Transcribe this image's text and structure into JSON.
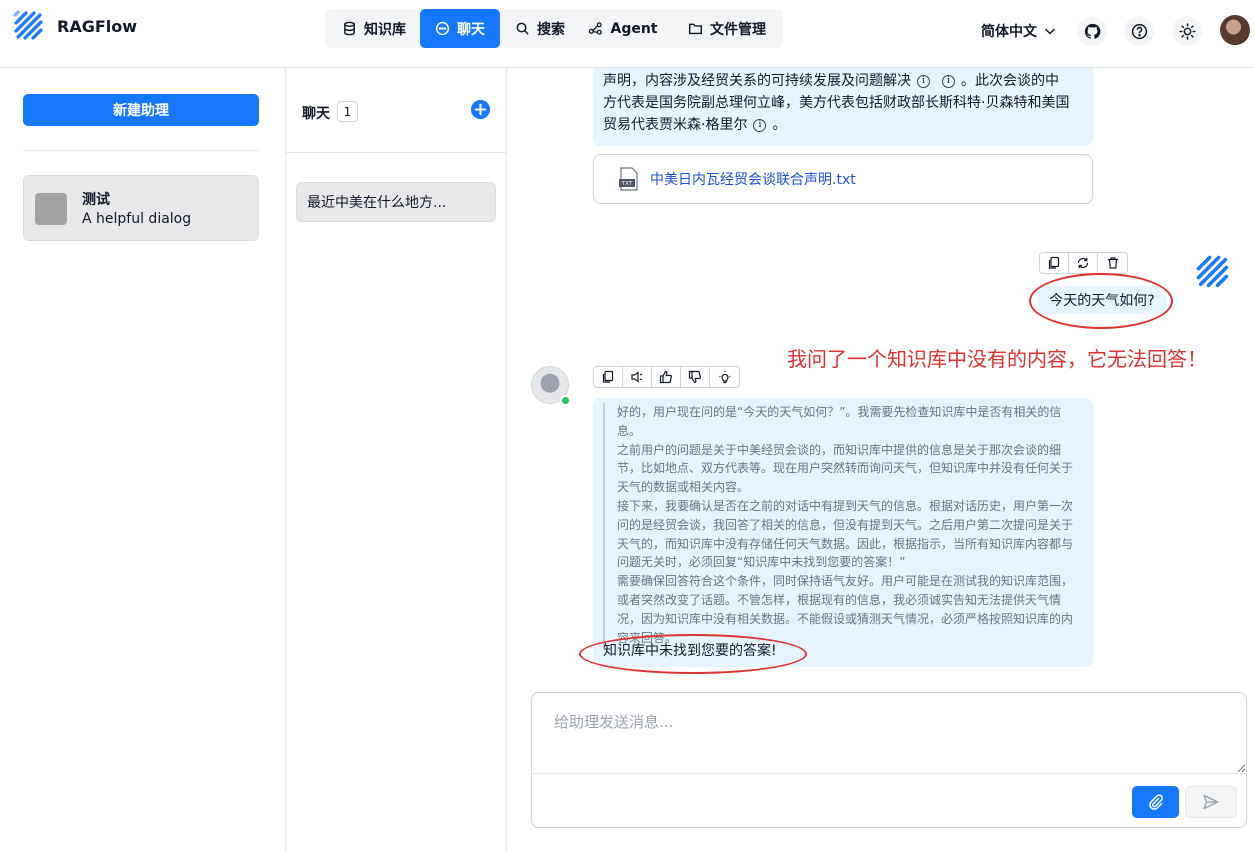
{
  "app": {
    "brand": "RAGFlow"
  },
  "nav": {
    "items": [
      {
        "label": "知识库",
        "icon": "database-icon"
      },
      {
        "label": "聊天",
        "icon": "chat-bubble-icon",
        "active": true
      },
      {
        "label": "搜索",
        "icon": "search-icon"
      },
      {
        "label": "Agent",
        "icon": "agent-graph-icon"
      },
      {
        "label": "文件管理",
        "icon": "folder-icon"
      }
    ]
  },
  "header": {
    "language": "简体中文",
    "icons": [
      "github-icon",
      "help-icon",
      "theme-sun-icon",
      "user-avatar"
    ]
  },
  "sidebar": {
    "new_assistant_label": "新建助理",
    "assistant": {
      "name": "测试",
      "description": "A helpful dialog"
    }
  },
  "conversations": {
    "title": "聊天",
    "count": "1",
    "items": [
      {
        "title": "最近中美在什么地方..."
      }
    ]
  },
  "chat": {
    "prev_answer": {
      "line1": "声明，内容涉及经贸关系的可持续发展及问题解决",
      "line1_tail": "。此次会谈的中",
      "line2": "方代表是国务院副总理何立峰，美方代表包括财政部长斯科特·贝森特和美国",
      "line3": "贸易代表贾米森·格里尔",
      "line3_tail": "。",
      "info_glyph": "i"
    },
    "file": {
      "name": "中美日内瓦经贸会谈联合声明.txt",
      "icon_label": "TXT"
    },
    "user_message": "今天的天气如何?",
    "annotation": "我问了一个知识库中没有的内容，它无法回答！",
    "thinking": [
      "好的，用户现在问的是“今天的天气如何？”。我需要先检查知识库中是否有相关的信息。",
      "之前用户的问题是关于中美经贸会谈的，而知识库中提供的信息是关于那次会谈的细",
      "节，比如地点、双方代表等。现在用户突然转而询问天气，但知识库中并没有任何关于",
      "天气的数据或相关内容。",
      "接下来，我要确认是否在之前的对话中有提到天气的信息。根据对话历史，用户第一次",
      "问的是经贸会谈，我回答了相关的信息，但没有提到天气。之后用户第二次提问是关于",
      "天气的，而知识库中没有存储任何天气数据。因此，根据指示，当所有知识库内容都与",
      "问题无关时，必须回复“知识库中未找到您要的答案！”",
      "需要确保回答符合这个条件，同时保持语气友好。用户可能是在测试我的知识库范围，",
      "或者突然改变了话题。不管怎样，根据现有的信息，我必须诚实告知无法提供天气情",
      "况，因为知识库中没有相关数据。不能假设或猜测天气情况，必须严格按照知识库的内",
      "容来回答。"
    ],
    "answer": "知识库中未找到您要的答案!",
    "input_placeholder": "给助理发送消息...",
    "colors": {
      "accent": "#1677ff",
      "bubble": "#e6f4ff",
      "annotation": "#e03131"
    }
  }
}
